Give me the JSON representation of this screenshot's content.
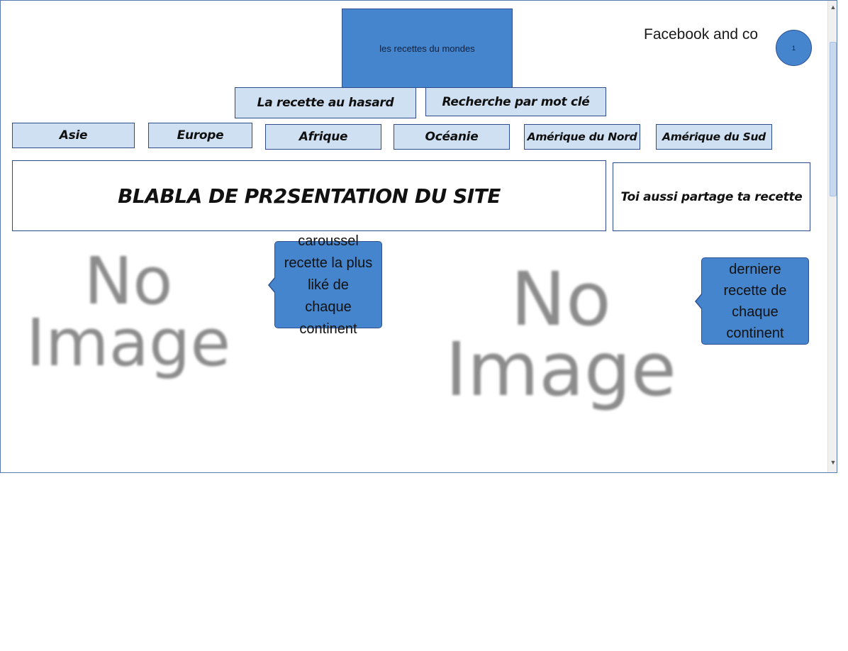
{
  "header": {
    "logo_text": "les recettes du mondes",
    "social_text": "Facebook and co",
    "badge_text": "1"
  },
  "top_buttons": {
    "random": "La recette au hasard",
    "search": "Recherche par mot clé"
  },
  "continents": [
    "Asie",
    "Europe",
    "Afrique",
    "Océanie",
    "Amérique du Nord",
    "Amérique du Sud"
  ],
  "presentation": {
    "title": "BLABLA DE PR2SENTATION DU SITE",
    "share": "Toi aussi partage ta recette"
  },
  "callouts": {
    "carousel": [
      "caroussel",
      "recette la plus",
      "liké de",
      "chaque",
      "continent"
    ],
    "latest": [
      "derniere",
      "recette de",
      "chaque",
      "continent"
    ]
  },
  "placeholders": {
    "line1": "No",
    "line2": "Image"
  },
  "colors": {
    "accent": "#4485ce",
    "light": "#cfe0f2",
    "border": "#2f4b8c"
  }
}
